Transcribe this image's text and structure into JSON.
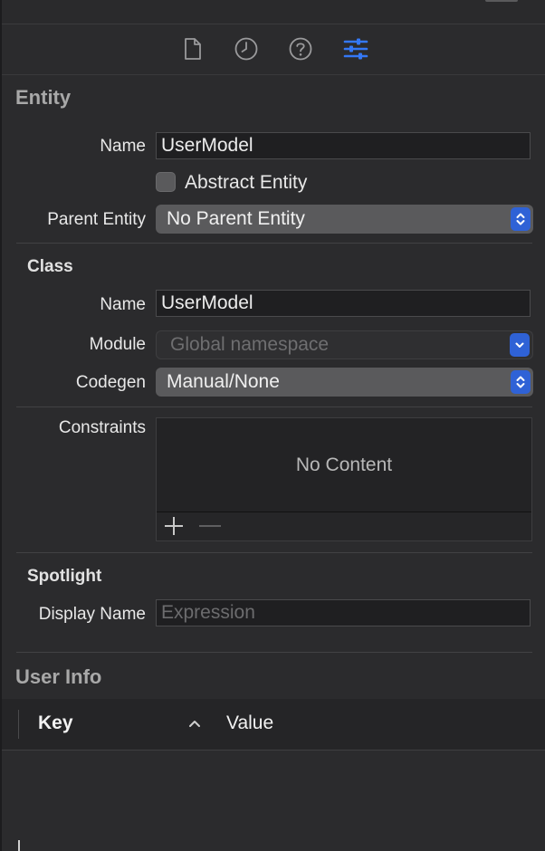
{
  "tabs": [
    {
      "icon": "file-icon",
      "active": false
    },
    {
      "icon": "history-clock-icon",
      "active": false
    },
    {
      "icon": "help-question-icon",
      "active": false
    },
    {
      "icon": "attributes-sliders-icon",
      "active": true
    }
  ],
  "colors": {
    "accent": "#3478f6",
    "background": "#2b2b2d",
    "stepper": "#2f62d6"
  },
  "entity": {
    "title": "Entity",
    "name_label": "Name",
    "name_value": "UserModel",
    "abstract_label": "Abstract Entity",
    "abstract_checked": false,
    "parent_label": "Parent Entity",
    "parent_value": "No Parent Entity"
  },
  "class": {
    "title": "Class",
    "name_label": "Name",
    "name_value": "UserModel",
    "module_label": "Module",
    "module_placeholder": "Global namespace",
    "codegen_label": "Codegen",
    "codegen_value": "Manual/None"
  },
  "constraints": {
    "label": "Constraints",
    "empty_text": "No Content",
    "add_icon": "plus-icon",
    "remove_icon": "minus-icon"
  },
  "spotlight": {
    "title": "Spotlight",
    "display_name_label": "Display Name",
    "display_name_placeholder": "Expression"
  },
  "user_info": {
    "title": "User Info",
    "columns": [
      "Key",
      "Value"
    ],
    "sort_icon": "chevron-up-icon"
  }
}
